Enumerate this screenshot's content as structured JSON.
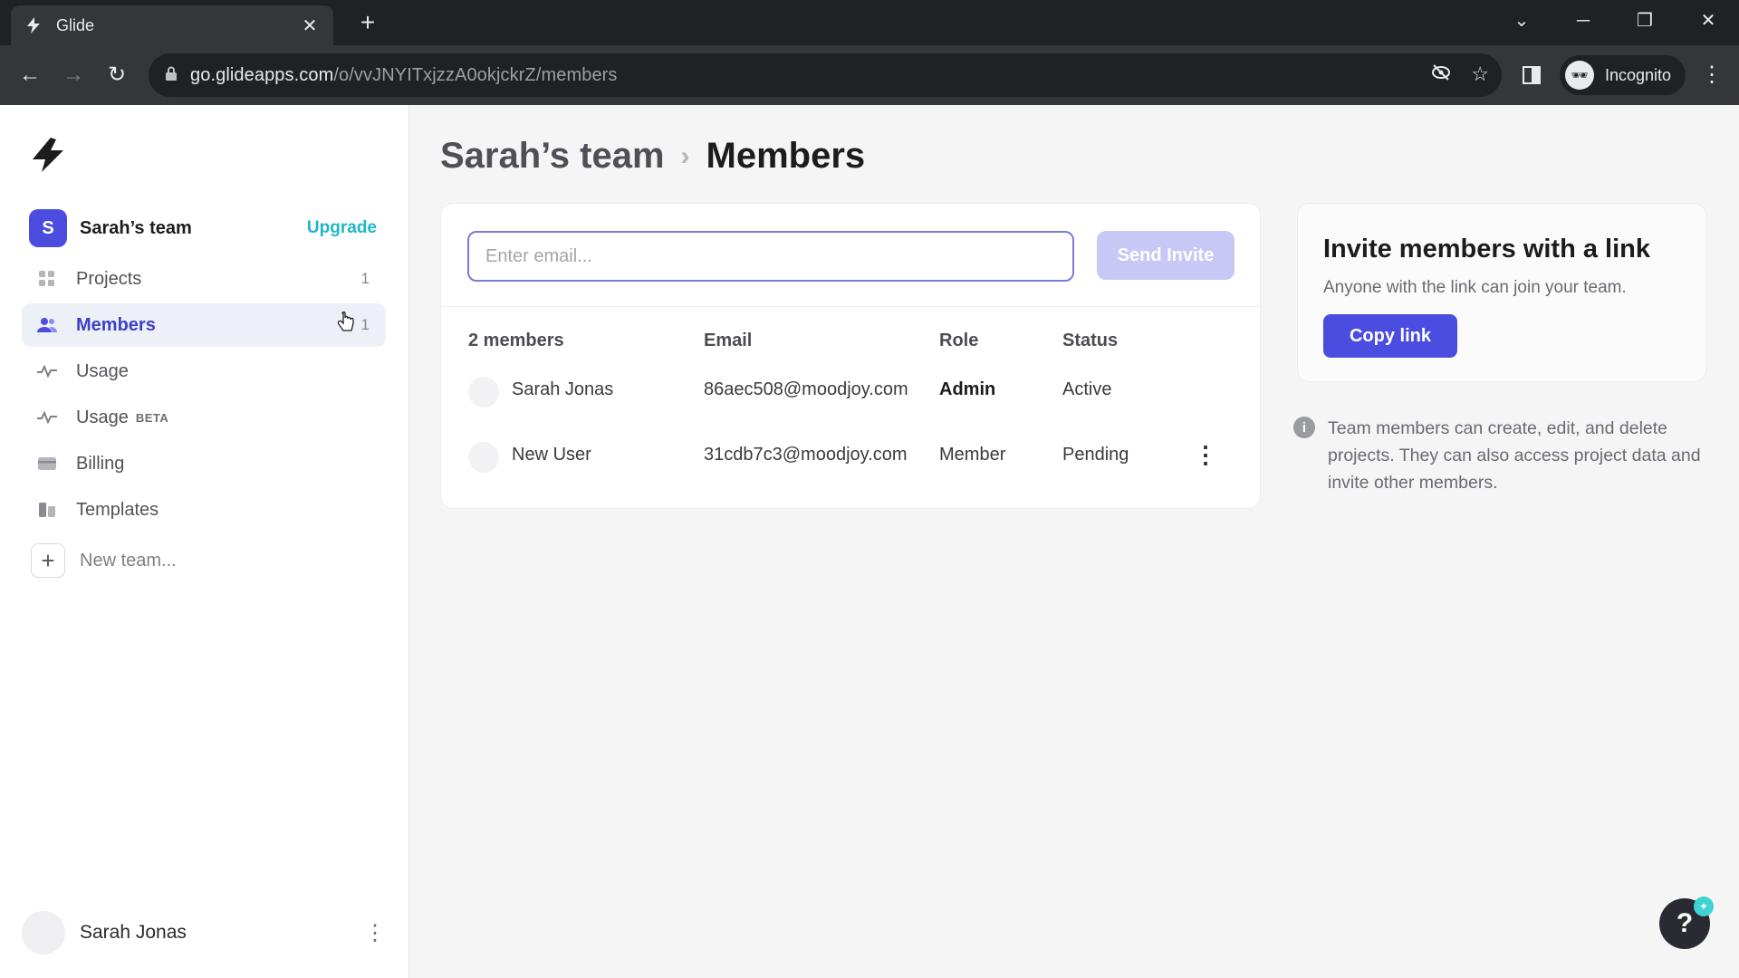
{
  "browser": {
    "tab_title": "Glide",
    "tab_close": "✕",
    "new_tab": "+",
    "url_host": "go.glideapps.com",
    "url_path": "/o/vvJNYITxjzzA0okjckrZ/members",
    "incognito_label": "Incognito"
  },
  "sidebar": {
    "team_initial": "S",
    "team_name": "Sarah’s team",
    "upgrade_label": "Upgrade",
    "items": [
      {
        "label": "Projects",
        "count": "1",
        "icon": "grid-icon"
      },
      {
        "label": "Members",
        "count": "1",
        "icon": "users-icon",
        "active": true
      },
      {
        "label": "Usage",
        "icon": "activity-icon"
      },
      {
        "label": "Usage",
        "badge": "BETA",
        "icon": "activity-icon"
      },
      {
        "label": "Billing",
        "icon": "card-icon"
      },
      {
        "label": "Templates",
        "icon": "templates-icon"
      }
    ],
    "new_team_label": "New team...",
    "user_name": "Sarah Jonas"
  },
  "breadcrumb": {
    "team": "Sarah’s team",
    "separator": "›",
    "page": "Members"
  },
  "invite": {
    "placeholder": "Enter email...",
    "send_label": "Send Invite"
  },
  "table": {
    "headers": [
      "2 members",
      "Email",
      "Role",
      "Status"
    ],
    "rows": [
      {
        "name": "Sarah Jonas",
        "email": "86aec508@moodjoy.com",
        "role": "Admin",
        "status": "Active"
      },
      {
        "name": "New User",
        "email": "31cdb7c3@moodjoy.com",
        "role": "Member",
        "status": "Pending"
      }
    ]
  },
  "link_card": {
    "title": "Invite members with a link",
    "subtitle": "Anyone with the link can join your team.",
    "button": "Copy link"
  },
  "info_text": "Team members can create, edit, and delete projects. They can also access project data and invite other members.",
  "help_label": "?",
  "colors": {
    "accent": "#4b4de0",
    "upgrade": "#1fb6c8",
    "send_disabled": "#c7c8f5"
  }
}
